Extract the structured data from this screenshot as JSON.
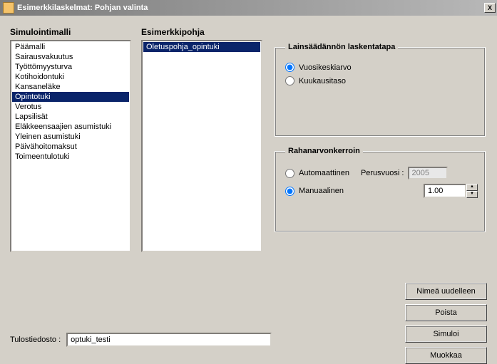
{
  "window": {
    "title": "Esimerkkilaskelmat: Pohjan valinta",
    "close": "X"
  },
  "simulointi": {
    "label": "Simulointimalli",
    "items": [
      "Päämalli",
      "Sairausvakuutus",
      "Työttömyysturva",
      "Kotihoidontuki",
      "Kansaneläke",
      "Opintotuki",
      "Verotus",
      "Lapsilisät",
      "Eläkkeensaajien asumistuki",
      "Yleinen asumistuki",
      "Päivähoitomaksut",
      "Toimeentulotuki"
    ],
    "selected_index": 5
  },
  "esimerkkipohja": {
    "label": "Esimerkkipohja",
    "items": [
      "Oletuspohja_opintuki"
    ],
    "selected_index": 0
  },
  "laskentatapa": {
    "legend": "Lainsäädännön laskentatapa",
    "opt_vuosi": "Vuosikeskiarvo",
    "opt_kk": "Kuukausitaso",
    "selected": "vuosi"
  },
  "rahakerroin": {
    "legend": "Rahanarvonkerroin",
    "opt_auto": "Automaattinen",
    "opt_man": "Manuaalinen",
    "selected": "man",
    "perusvuosi_label": "Perusvuosi :",
    "perusvuosi_value": "2005",
    "man_value": "1.00"
  },
  "buttons": {
    "rename": "Nimeä uudelleen",
    "delete": "Poista",
    "simulate": "Simuloi",
    "edit": "Muokkaa"
  },
  "output": {
    "label": "Tulostiedosto :",
    "value": "optuki_testi"
  }
}
